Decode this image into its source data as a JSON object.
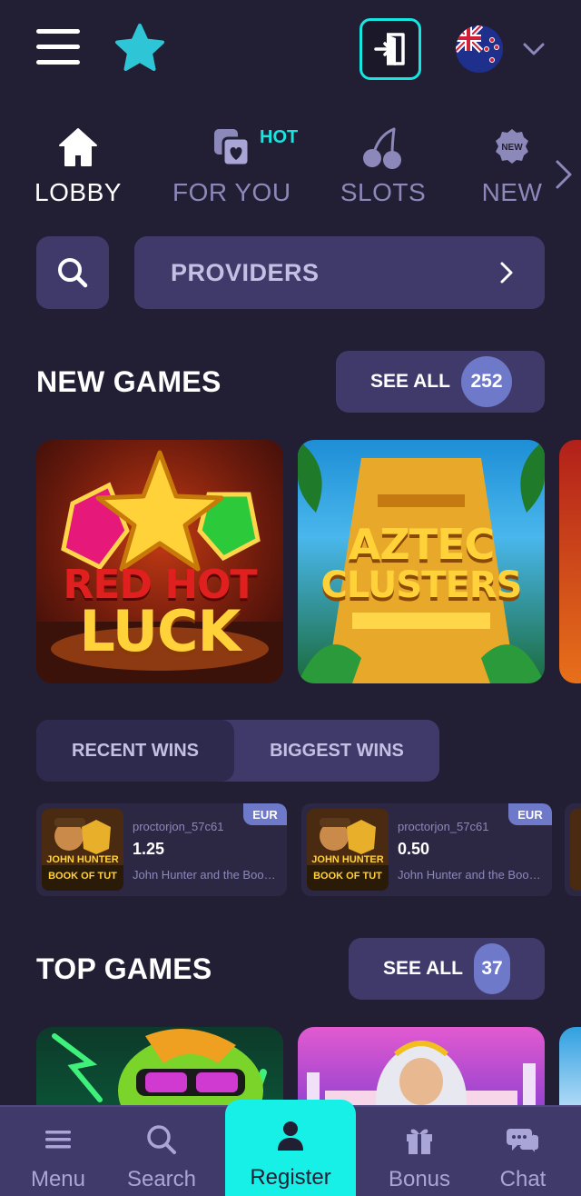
{
  "header": {
    "menu_icon": "hamburger-icon",
    "favorites_icon": "star-icon",
    "login_icon": "login-icon",
    "language_flag": "new-zealand-flag-icon"
  },
  "nav": {
    "tabs": [
      {
        "label": "LOBBY",
        "icon": "home-icon",
        "active": true
      },
      {
        "label": "FOR YOU",
        "icon": "heart-cards-icon",
        "badge": "HOT"
      },
      {
        "label": "SLOTS",
        "icon": "cherries-icon"
      },
      {
        "label": "NEW",
        "icon": "new-badge-icon",
        "icon_text": "NEW"
      }
    ]
  },
  "providers": {
    "label": "PROVIDERS"
  },
  "new_games": {
    "title": "NEW GAMES",
    "see_all": "SEE ALL",
    "count": "252",
    "games": [
      {
        "title_line1": "RED HOT",
        "title_line2": "LUCK"
      },
      {
        "title_line1": "AZTEC",
        "title_line2": "CLUSTERS"
      }
    ]
  },
  "wins": {
    "tabs": [
      "RECENT WINS",
      "BIGGEST WINS"
    ],
    "active_tab": 0,
    "items": [
      {
        "user": "proctorjon_57c61",
        "amount": "1.25",
        "game": "John Hunter and the Book of Tut",
        "currency": "EUR",
        "thumb_line1": "JOHN HUNTER",
        "thumb_line2": "BOOK OF TUT"
      },
      {
        "user": "proctorjon_57c61",
        "amount": "0.50",
        "game": "John Hunter and the Book of Tut",
        "currency": "EUR",
        "thumb_line1": "JOHN HUNTER",
        "thumb_line2": "BOOK OF TUT"
      }
    ]
  },
  "top_games": {
    "title": "TOP GAMES",
    "see_all": "SEE ALL",
    "count": "37"
  },
  "bottom_bar": {
    "menu": "Menu",
    "search": "Search",
    "register": "Register",
    "bonus": "Bonus",
    "chat": "Chat"
  },
  "colors": {
    "background": "#221e33",
    "panel": "#3f3a6a",
    "accent": "#17e6e0",
    "muted_text": "#8c88b9",
    "count_badge": "#6f79c9"
  }
}
